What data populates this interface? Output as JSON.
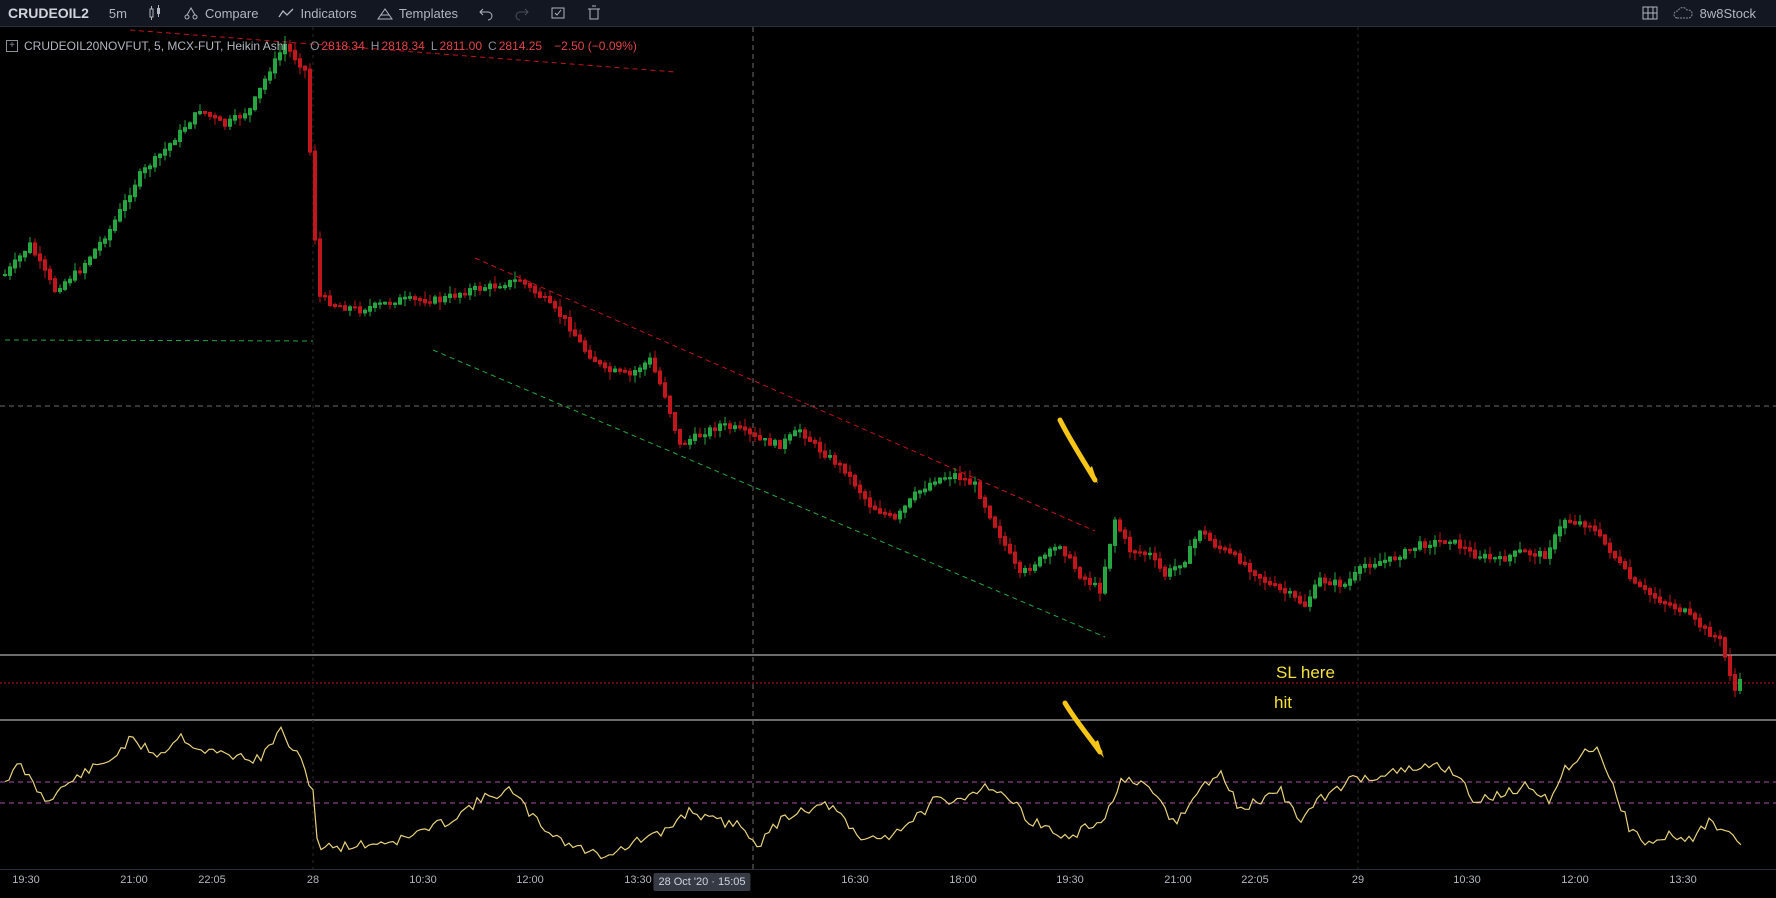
{
  "toolbar": {
    "symbol": "CRUDEOIL2",
    "interval": "5m",
    "compare_label": "Compare",
    "indicators_label": "Indicators",
    "templates_label": "Templates",
    "account_label": "8w8Stock"
  },
  "legend": {
    "title": "CRUDEOIL20NOVFUT, 5, MCX-FUT, Heikin Ashi",
    "open_k": "O",
    "open": "2818.34",
    "high_k": "H",
    "high": "2818.34",
    "low_k": "L",
    "low": "2811.00",
    "close_k": "C",
    "close": "2814.25",
    "change": "−2.50 (−0.09%)"
  },
  "notes": {
    "sl_here": "SL   here",
    "hit": "hit"
  },
  "time_axis": {
    "labels": [
      "19:30",
      "21:00",
      "22:05",
      "28",
      "10:30",
      "12:00",
      "13:30",
      "16:30",
      "18:00",
      "19:30",
      "21:00",
      "22:05",
      "29",
      "10:30",
      "12:00",
      "13:30"
    ],
    "crosshair_label": "28 Oct '20 · 15:05"
  },
  "colors": {
    "up": "#26a641",
    "down": "#c0161c",
    "rsi_line": "#e8d27a",
    "note": "#f5e13b",
    "background": "#000000"
  },
  "chart_data": {
    "type": "candlestick",
    "style": "Heikin Ashi",
    "symbol": "CRUDEOIL20NOVFUT",
    "interval": "5",
    "exchange": "MCX-FUT",
    "last_bar": {
      "open": 2818.34,
      "high": 2818.34,
      "low": 2811.0,
      "close": 2814.25,
      "change": -2.5,
      "change_pct": -0.09
    },
    "x_ticks": [
      "19:30",
      "21:00",
      "22:05",
      "28",
      "10:30",
      "12:00",
      "13:30",
      "16:30",
      "18:00",
      "19:30",
      "21:00",
      "22:05",
      "29",
      "10:30",
      "12:00",
      "13:30"
    ],
    "lower_pane": "oscillator line with two dashed reference levels",
    "grid": false
  }
}
